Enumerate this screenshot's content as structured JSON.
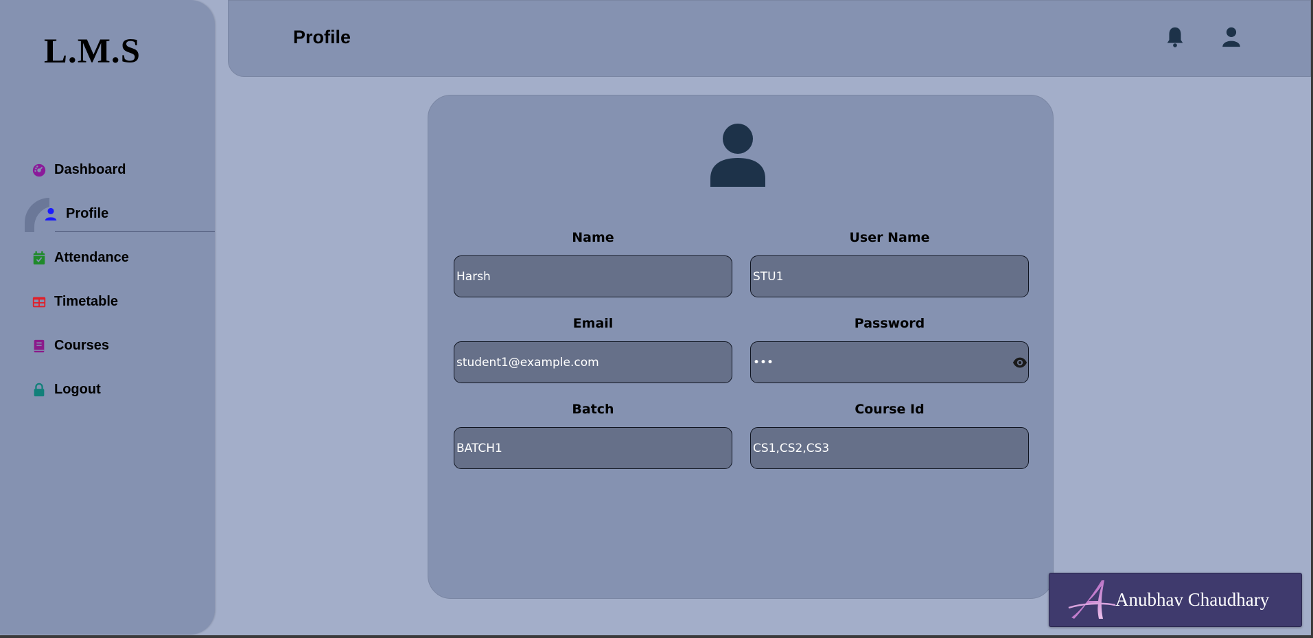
{
  "app": {
    "logo": "L.M.S"
  },
  "sidebar": {
    "items": [
      {
        "label": "Dashboard",
        "icon": "dashboard-icon",
        "color": "#8b1a9a"
      },
      {
        "label": "Profile",
        "icon": "user-icon",
        "color": "#1a1aff",
        "active": true
      },
      {
        "label": "Attendance",
        "icon": "calendar-check-icon",
        "color": "#1f8a2a"
      },
      {
        "label": "Timetable",
        "icon": "table-icon",
        "color": "#e0202a"
      },
      {
        "label": "Courses",
        "icon": "book-icon",
        "color": "#8b1a8a"
      },
      {
        "label": "Logout",
        "icon": "lock-icon",
        "color": "#12807a"
      }
    ]
  },
  "header": {
    "title": "Profile",
    "icons": [
      "bell-icon",
      "user-icon"
    ]
  },
  "profile": {
    "name_label": "Name",
    "name_value": "Harsh",
    "username_label": "User Name",
    "username_value": "STU1",
    "email_label": "Email",
    "email_value": "student1@example.com",
    "password_label": "Password",
    "password_value": "•••",
    "batch_label": "Batch",
    "batch_value": "BATCH1",
    "courseid_label": "Course Id",
    "courseid_value": "CS1,CS2,CS3"
  },
  "signature": {
    "name": "Anubhav Chaudhary"
  }
}
